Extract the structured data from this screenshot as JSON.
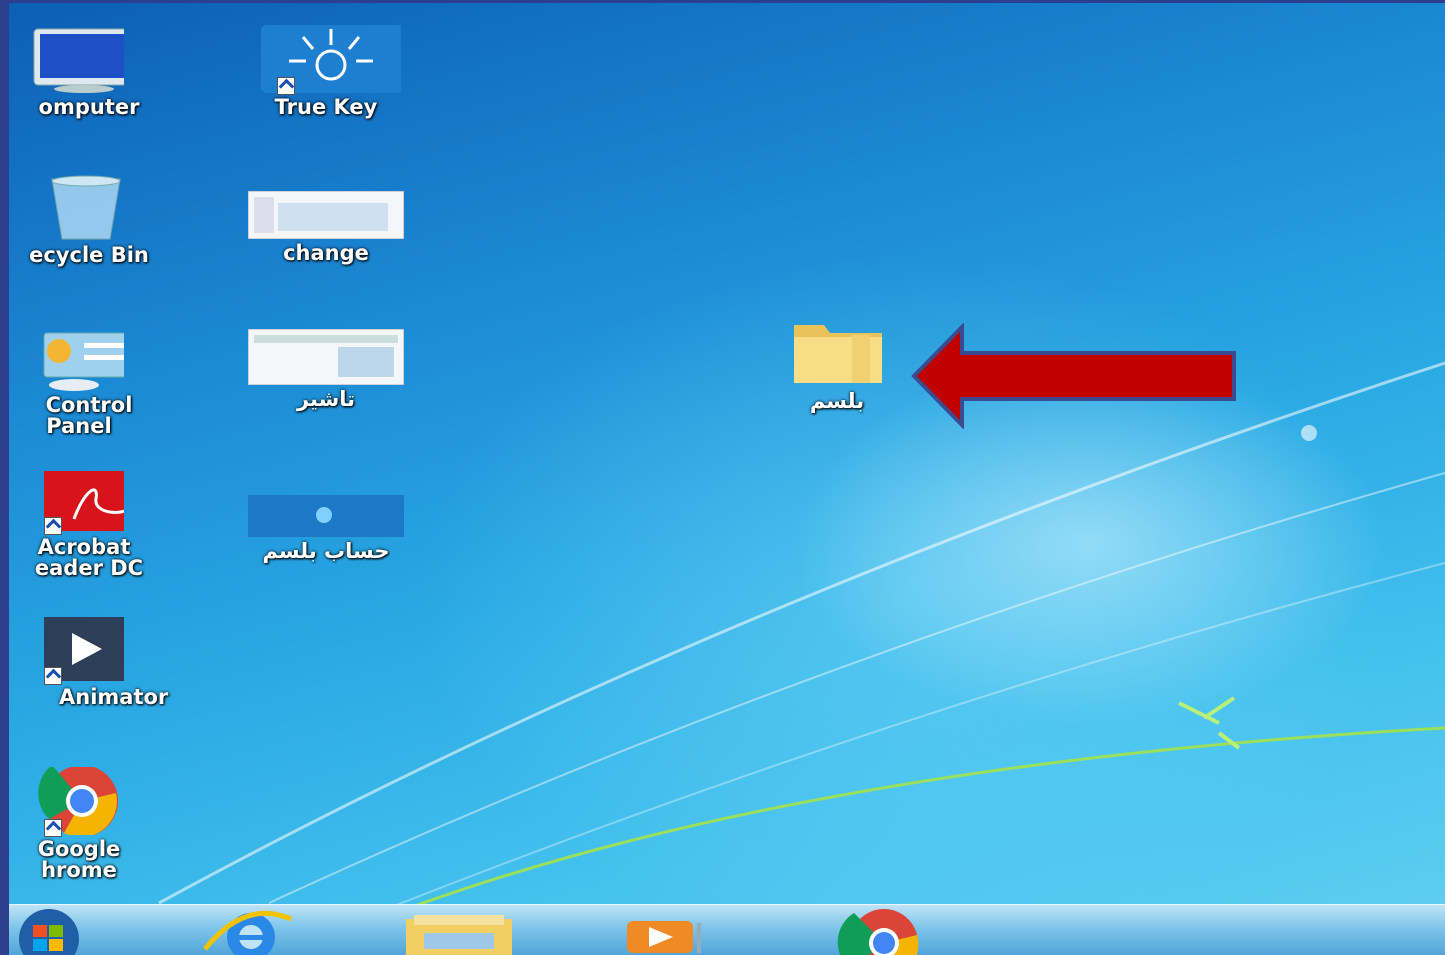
{
  "desktop": {
    "icons": [
      {
        "label": "omputer",
        "icon": "computer-icon"
      },
      {
        "label": "True Key",
        "icon": "truekey-icon"
      },
      {
        "label": "ecycle Bin",
        "icon": "recycle-bin-icon"
      },
      {
        "label": "change",
        "icon": "document-thumbnail-icon"
      },
      {
        "label": "Control",
        "label2": "Panel",
        "icon": "control-panel-icon"
      },
      {
        "label": "تاشير",
        "icon": "document-thumbnail-icon"
      },
      {
        "label": "Acrobat",
        "label2": "eader DC",
        "icon": "acrobat-icon"
      },
      {
        "label": "حساب بلسم",
        "icon": "windows-thumbnail-icon"
      },
      {
        "label": "Animator",
        "icon": "animator-icon"
      },
      {
        "label": "Google",
        "label2": "hrome",
        "icon": "chrome-icon"
      },
      {
        "label": "بلسم",
        "icon": "folder-icon"
      }
    ],
    "arrow_color": "#c00000"
  },
  "taskbar": {
    "items": [
      "start-orb-icon",
      "internet-explorer-icon",
      "file-explorer-icon",
      "media-player-icon",
      "chrome-icon"
    ]
  }
}
